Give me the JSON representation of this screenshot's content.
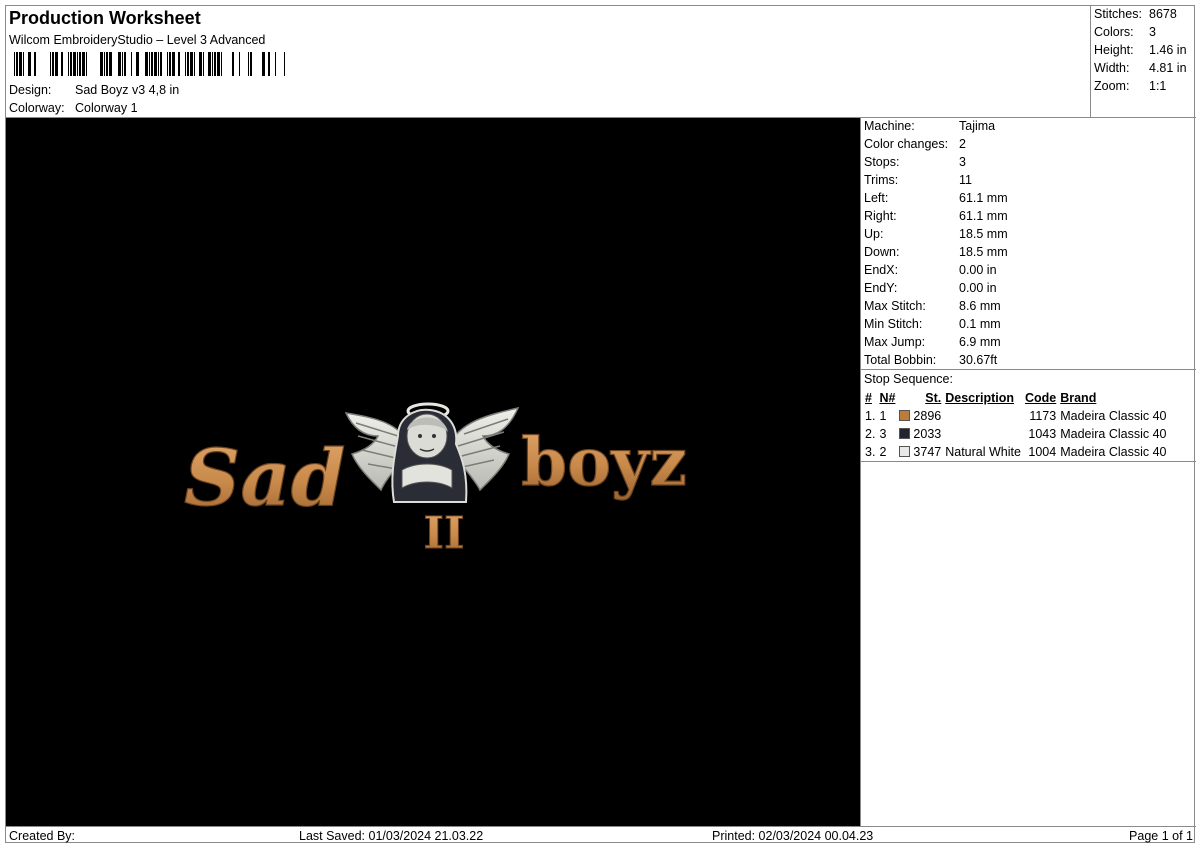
{
  "header": {
    "title": "Production Worksheet",
    "subtitle": "Wilcom EmbroideryStudio – Level 3 Advanced",
    "design_label": "Design:",
    "design_value": "Sad Boyz v3 4,8 in",
    "colorway_label": "Colorway:",
    "colorway_value": "Colorway 1"
  },
  "summary": [
    {
      "label": "Stitches:",
      "value": "8678"
    },
    {
      "label": "Colors:",
      "value": "3"
    },
    {
      "label": "Height:",
      "value": "1.46 in"
    },
    {
      "label": "Width:",
      "value": "4.81 in"
    },
    {
      "label": "Zoom:",
      "value": "1:1"
    }
  ],
  "machine": [
    {
      "label": "Machine:",
      "value": "Tajima"
    },
    {
      "label": "Color changes:",
      "value": "2"
    },
    {
      "label": "Stops:",
      "value": "3"
    },
    {
      "label": "Trims:",
      "value": "11"
    },
    {
      "label": "Left:",
      "value": "61.1 mm"
    },
    {
      "label": "Right:",
      "value": "61.1 mm"
    },
    {
      "label": "Up:",
      "value": "18.5 mm"
    },
    {
      "label": "Down:",
      "value": "18.5 mm"
    },
    {
      "label": "EndX:",
      "value": "0.00 in"
    },
    {
      "label": "EndY:",
      "value": "0.00 in"
    },
    {
      "label": "Max Stitch:",
      "value": "8.6 mm"
    },
    {
      "label": "Min Stitch:",
      "value": "0.1 mm"
    },
    {
      "label": "Max Jump:",
      "value": "6.9 mm"
    },
    {
      "label": "Total Bobbin:",
      "value": "30.67ft"
    }
  ],
  "stop_sequence": {
    "label": "Stop Sequence:",
    "columns": [
      "#",
      "N#",
      "St.",
      "Description",
      "Code",
      "Brand"
    ],
    "rows": [
      {
        "num": "1.",
        "n": "1",
        "color": "#c07a3a",
        "st": "2896",
        "description": "",
        "code": "1173",
        "brand": "Madeira Classic 40"
      },
      {
        "num": "2.",
        "n": "3",
        "color": "#22252e",
        "st": "2033",
        "description": "",
        "code": "1043",
        "brand": "Madeira Classic 40"
      },
      {
        "num": "3.",
        "n": "2",
        "color": "#e9e9ec",
        "st": "3747",
        "description": "Natural White",
        "code": "1004",
        "brand": "Madeira Classic 40"
      }
    ]
  },
  "design_art": {
    "word_left": "Sad",
    "word_right": "boyz",
    "numeral": "II",
    "thread_gold": "#c8894a",
    "thread_white": "#dcdcd6",
    "thread_dark": "#22252e"
  },
  "footer": {
    "created_by": "Created By:",
    "last_saved": "Last Saved: 01/03/2024 21.03.22",
    "printed": "Printed: 02/03/2024 00.04.23",
    "page": "Page 1 of 1"
  }
}
